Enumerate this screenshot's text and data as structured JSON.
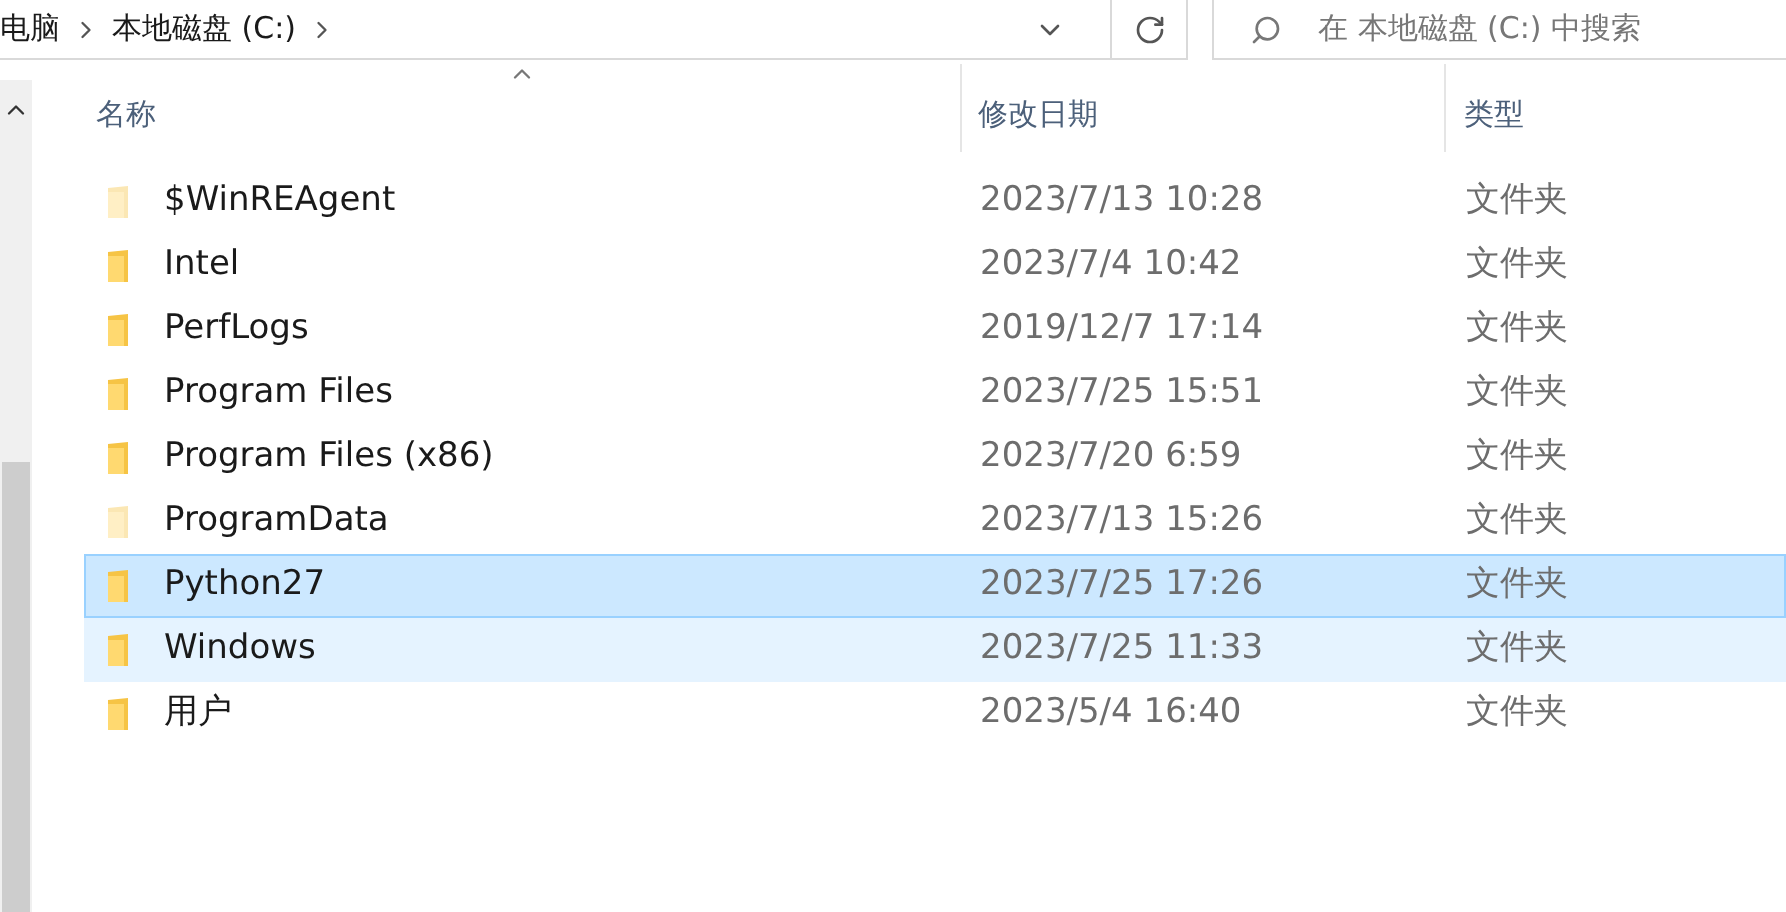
{
  "address_bar": {
    "breadcrumbs": [
      "电脑",
      "本地磁盘 (C:)"
    ]
  },
  "search": {
    "placeholder": "在 本地磁盘 (C:) 中搜索"
  },
  "table": {
    "columns": [
      {
        "label": "名称",
        "sorted": true
      },
      {
        "label": "修改日期",
        "sorted": false
      },
      {
        "label": "类型",
        "sorted": false
      }
    ],
    "rows": [
      {
        "name": "$WinREAgent",
        "modified": "2023/7/13 10:28",
        "type": "文件夹",
        "hidden": true,
        "selected": false,
        "hovered": false
      },
      {
        "name": "Intel",
        "modified": "2023/7/4 10:42",
        "type": "文件夹",
        "hidden": false,
        "selected": false,
        "hovered": false
      },
      {
        "name": "PerfLogs",
        "modified": "2019/12/7 17:14",
        "type": "文件夹",
        "hidden": false,
        "selected": false,
        "hovered": false
      },
      {
        "name": "Program Files",
        "modified": "2023/7/25 15:51",
        "type": "文件夹",
        "hidden": false,
        "selected": false,
        "hovered": false
      },
      {
        "name": "Program Files (x86)",
        "modified": "2023/7/20 6:59",
        "type": "文件夹",
        "hidden": false,
        "selected": false,
        "hovered": false
      },
      {
        "name": "ProgramData",
        "modified": "2023/7/13 15:26",
        "type": "文件夹",
        "hidden": true,
        "selected": false,
        "hovered": false
      },
      {
        "name": "Python27",
        "modified": "2023/7/25 17:26",
        "type": "文件夹",
        "hidden": false,
        "selected": true,
        "hovered": false
      },
      {
        "name": "Windows",
        "modified": "2023/7/25 11:33",
        "type": "文件夹",
        "hidden": false,
        "selected": false,
        "hovered": true
      },
      {
        "name": "用户",
        "modified": "2023/5/4 16:40",
        "type": "文件夹",
        "hidden": false,
        "selected": false,
        "hovered": false
      }
    ]
  }
}
